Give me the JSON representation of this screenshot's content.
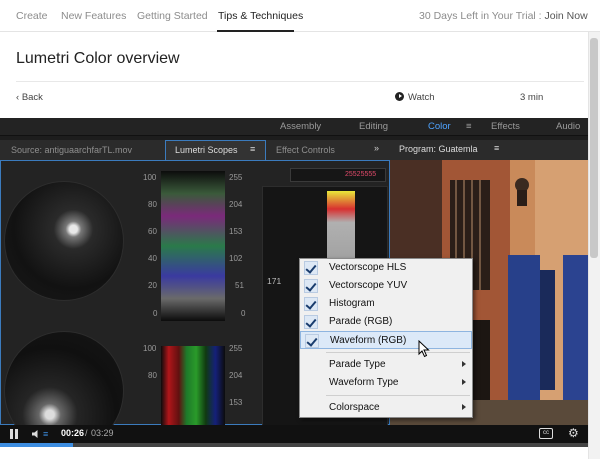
{
  "top_nav": {
    "tabs": [
      {
        "label": "Create"
      },
      {
        "label": "New Features"
      },
      {
        "label": "Getting Started"
      },
      {
        "label": "Tips & Techniques",
        "active": true
      }
    ],
    "trial_text": "30 Days Left in Your Trial :",
    "join_label": "Join Now"
  },
  "page": {
    "title": "Lumetri Color overview",
    "back_label": "Back",
    "watch_label": "Watch",
    "duration": "3 min"
  },
  "video": {
    "workspaces": [
      "Assembly",
      "Editing",
      "Color",
      "Effects",
      "Audio"
    ],
    "active_workspace": "Color",
    "source_tab": "Source: antiguaarchfarTL.mov",
    "scopes_tab": "Lumetri Scopes",
    "effect_controls_tab": "Effect Controls",
    "program_tab": "Program: Guatemla",
    "waveform_left_ticks": [
      "100",
      "80",
      "60",
      "40",
      "20",
      "0"
    ],
    "waveform_right_ticks": [
      "255",
      "204",
      "153",
      "102",
      "51",
      "0"
    ],
    "lower_left_ticks": [
      "100",
      "80"
    ],
    "lower_right_ticks": [
      "255",
      "204",
      "153"
    ],
    "parade_tick": "171",
    "parade_mini_label": "25525555",
    "context_menu": {
      "items": [
        {
          "label": "Vectorscope HLS",
          "checked": true
        },
        {
          "label": "Vectorscope YUV",
          "checked": true
        },
        {
          "label": "Histogram",
          "checked": true
        },
        {
          "label": "Parade (RGB)",
          "checked": true
        },
        {
          "label": "Waveform (RGB)",
          "checked": true,
          "highlighted": true
        }
      ],
      "submenus": [
        {
          "label": "Parade Type"
        },
        {
          "label": "Waveform Type"
        },
        {
          "label": "Colorspace"
        }
      ]
    },
    "controls": {
      "time_current": "00:26",
      "time_total": "03:29",
      "progress": 0.124
    }
  },
  "colors": {
    "accent_blue": "#3d8de0",
    "workspace_active": "#4ea3ff",
    "panel_dark": "#1d1d1d"
  }
}
